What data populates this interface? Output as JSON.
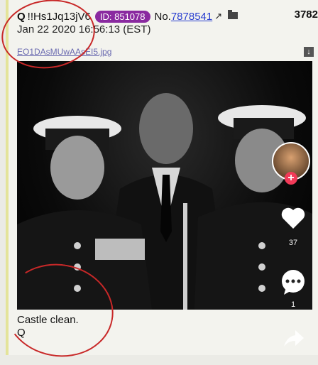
{
  "post": {
    "author": "Q",
    "tripcode": "!!Hs1Jq13jV6",
    "id_badge": "ID: 851078",
    "no_label": "No.",
    "post_number": "7878541",
    "reply_count": "3782",
    "date": "Jan 22 2020 16:56:13 (EST)",
    "filename": "EO1DAsMUwAAsEI5.jpg",
    "message_line1": "Castle clean.",
    "message_line2": "Q"
  },
  "social": {
    "likes": "37",
    "comments": "1"
  },
  "icons": [
    "external-link-icon",
    "folder-icon",
    "download-icon",
    "heart-icon",
    "comment-icon",
    "share-icon",
    "add-follow-icon"
  ],
  "colors": {
    "id_badge": "#8a2aa0",
    "link": "#2a3fd0",
    "annotation_circle": "#c82828",
    "follow_plus": "#f23a58"
  }
}
